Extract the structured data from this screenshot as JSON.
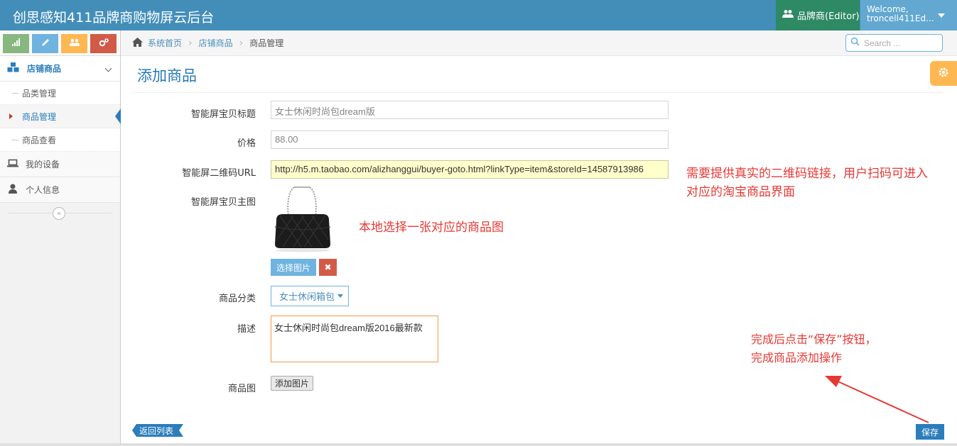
{
  "navbar": {
    "brand": "创思感知411品牌商购物屏云后台",
    "role_label": "品牌商(Editor)",
    "welcome": "Welcome,",
    "username": "troncell411Ed..."
  },
  "sidebar": {
    "group_label": "店铺商品",
    "sub_items": [
      {
        "label": "品类管理"
      },
      {
        "label": "商品管理"
      },
      {
        "label": "商品查看"
      }
    ],
    "items": [
      {
        "label": "我的设备"
      },
      {
        "label": "个人信息"
      }
    ],
    "collapse_glyph": "«"
  },
  "breadcrumb": {
    "home": "系统首页",
    "section": "店铺商品",
    "current": "商品管理"
  },
  "search": {
    "placeholder": "Search ..."
  },
  "page": {
    "title": "添加商品"
  },
  "form": {
    "title_label": "智能屏宝贝标题",
    "title_value": "女士休闲时尚包dream版",
    "price_label": "价格",
    "price_value": "88.00",
    "url_label": "智能屏二维码URL",
    "url_value": "http://h5.m.taobao.com/alizhanggui/buyer-goto.html?linkType=item&storeId=14587913986",
    "image_label": "智能屏宝贝主图",
    "select_image_button": "选择图片",
    "delete_glyph": "✖",
    "category_label": "商品分类",
    "category_value": "女士休闲箱包",
    "desc_label": "描述",
    "desc_value": "女士休闲时尚包dream版2016最新款",
    "gallery_label": "商品图",
    "add_image_button": "添加图片"
  },
  "annotations": {
    "url_note_line1": "需要提供真实的二维码链接，用户扫码可进入",
    "url_note_line2": "对应的淘宝商品界面",
    "image_note": "本地选择一张对应的商品图",
    "save_note_line1": "完成后点击“保存”按钮，",
    "save_note_line2": "完成商品添加操作"
  },
  "actions": {
    "back_label": "返回列表",
    "save_label": "保存"
  },
  "colors": {
    "navbar": "#438eb9",
    "role": "#2e8965",
    "user": "#62a8d1",
    "primary": "#2b7dbc",
    "annotation": "#e53935"
  }
}
